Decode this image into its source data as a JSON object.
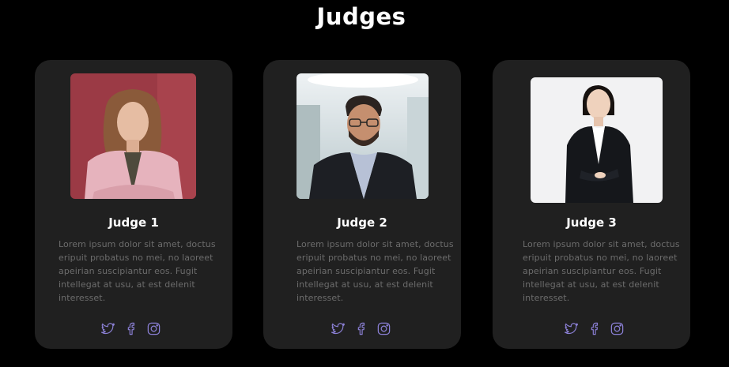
{
  "page": {
    "title": "Judges"
  },
  "judges": [
    {
      "name": "Judge 1",
      "bio": "Lorem ipsum dolor sit amet, doctus eripuit probatus no mei, no laoreet apeirian suscipiantur eos. Fugit intellegat at usu, at est delenit interesset.",
      "photo": "portrait-woman-pink-blazer",
      "socials": [
        "twitter-icon",
        "facebook-icon",
        "instagram-icon"
      ]
    },
    {
      "name": "Judge 2",
      "bio": "Lorem ipsum dolor sit amet, doctus eripuit probatus no mei, no laoreet apeirian suscipiantur eos. Fugit intellegat at usu, at est delenit interesset.",
      "photo": "portrait-man-glasses",
      "socials": [
        "twitter-icon",
        "facebook-icon",
        "instagram-icon"
      ]
    },
    {
      "name": "Judge 3",
      "bio": "Lorem ipsum dolor sit amet, doctus eripuit probatus no mei, no laoreet apeirian suscipiantur eos. Fugit intellegat at usu, at est delenit interesset.",
      "photo": "portrait-woman-black-suit",
      "socials": [
        "twitter-icon",
        "facebook-icon",
        "instagram-icon"
      ]
    }
  ],
  "colors": {
    "background": "#000000",
    "card": "#202020",
    "title": "#ffffff",
    "body_text": "#6c6c6c",
    "icon_accent": "#8a7fd4"
  }
}
